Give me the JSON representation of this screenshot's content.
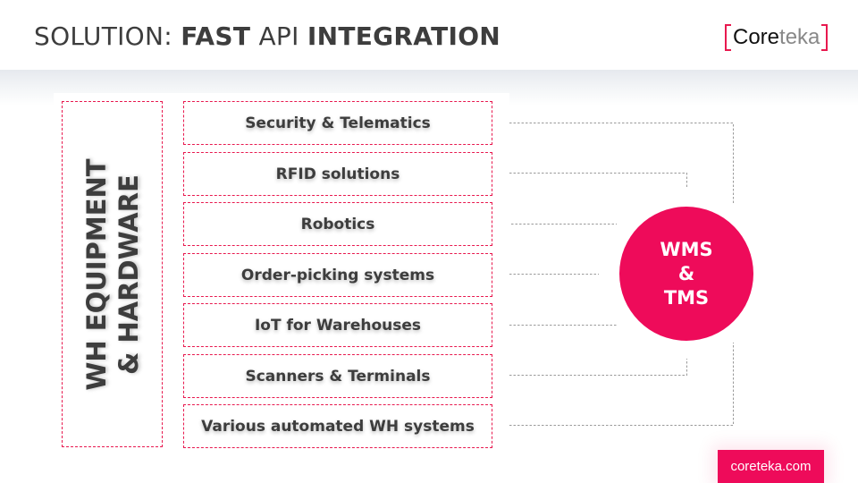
{
  "header": {
    "title_prefix": "SOLUTION: ",
    "title_strong_1": "FAST",
    "title_mid": " API ",
    "title_strong_2": "INTEGRATION",
    "logo": {
      "part_dark": "Core",
      "part_light": "teka",
      "bracket_color": "#e8194f"
    }
  },
  "diagram": {
    "group_label_line1": "WH EQUIPMENT",
    "group_label_line2": "& HARDWARE",
    "items": [
      {
        "label": "Security & Telematics"
      },
      {
        "label": "RFID solutions"
      },
      {
        "label": "Robotics"
      },
      {
        "label": "Order-picking systems"
      },
      {
        "label": "IoT for Warehouses"
      },
      {
        "label": "Scanners & Terminals"
      },
      {
        "label": "Various automated WH systems"
      }
    ],
    "hub": {
      "line1": "WMS",
      "line2": "&",
      "line3": "TMS",
      "color": "#ee0b5a"
    },
    "accent_color": "#e8194f",
    "connector_color": "#9a9a9a"
  },
  "footer": {
    "site_label": "coreteka.com"
  }
}
